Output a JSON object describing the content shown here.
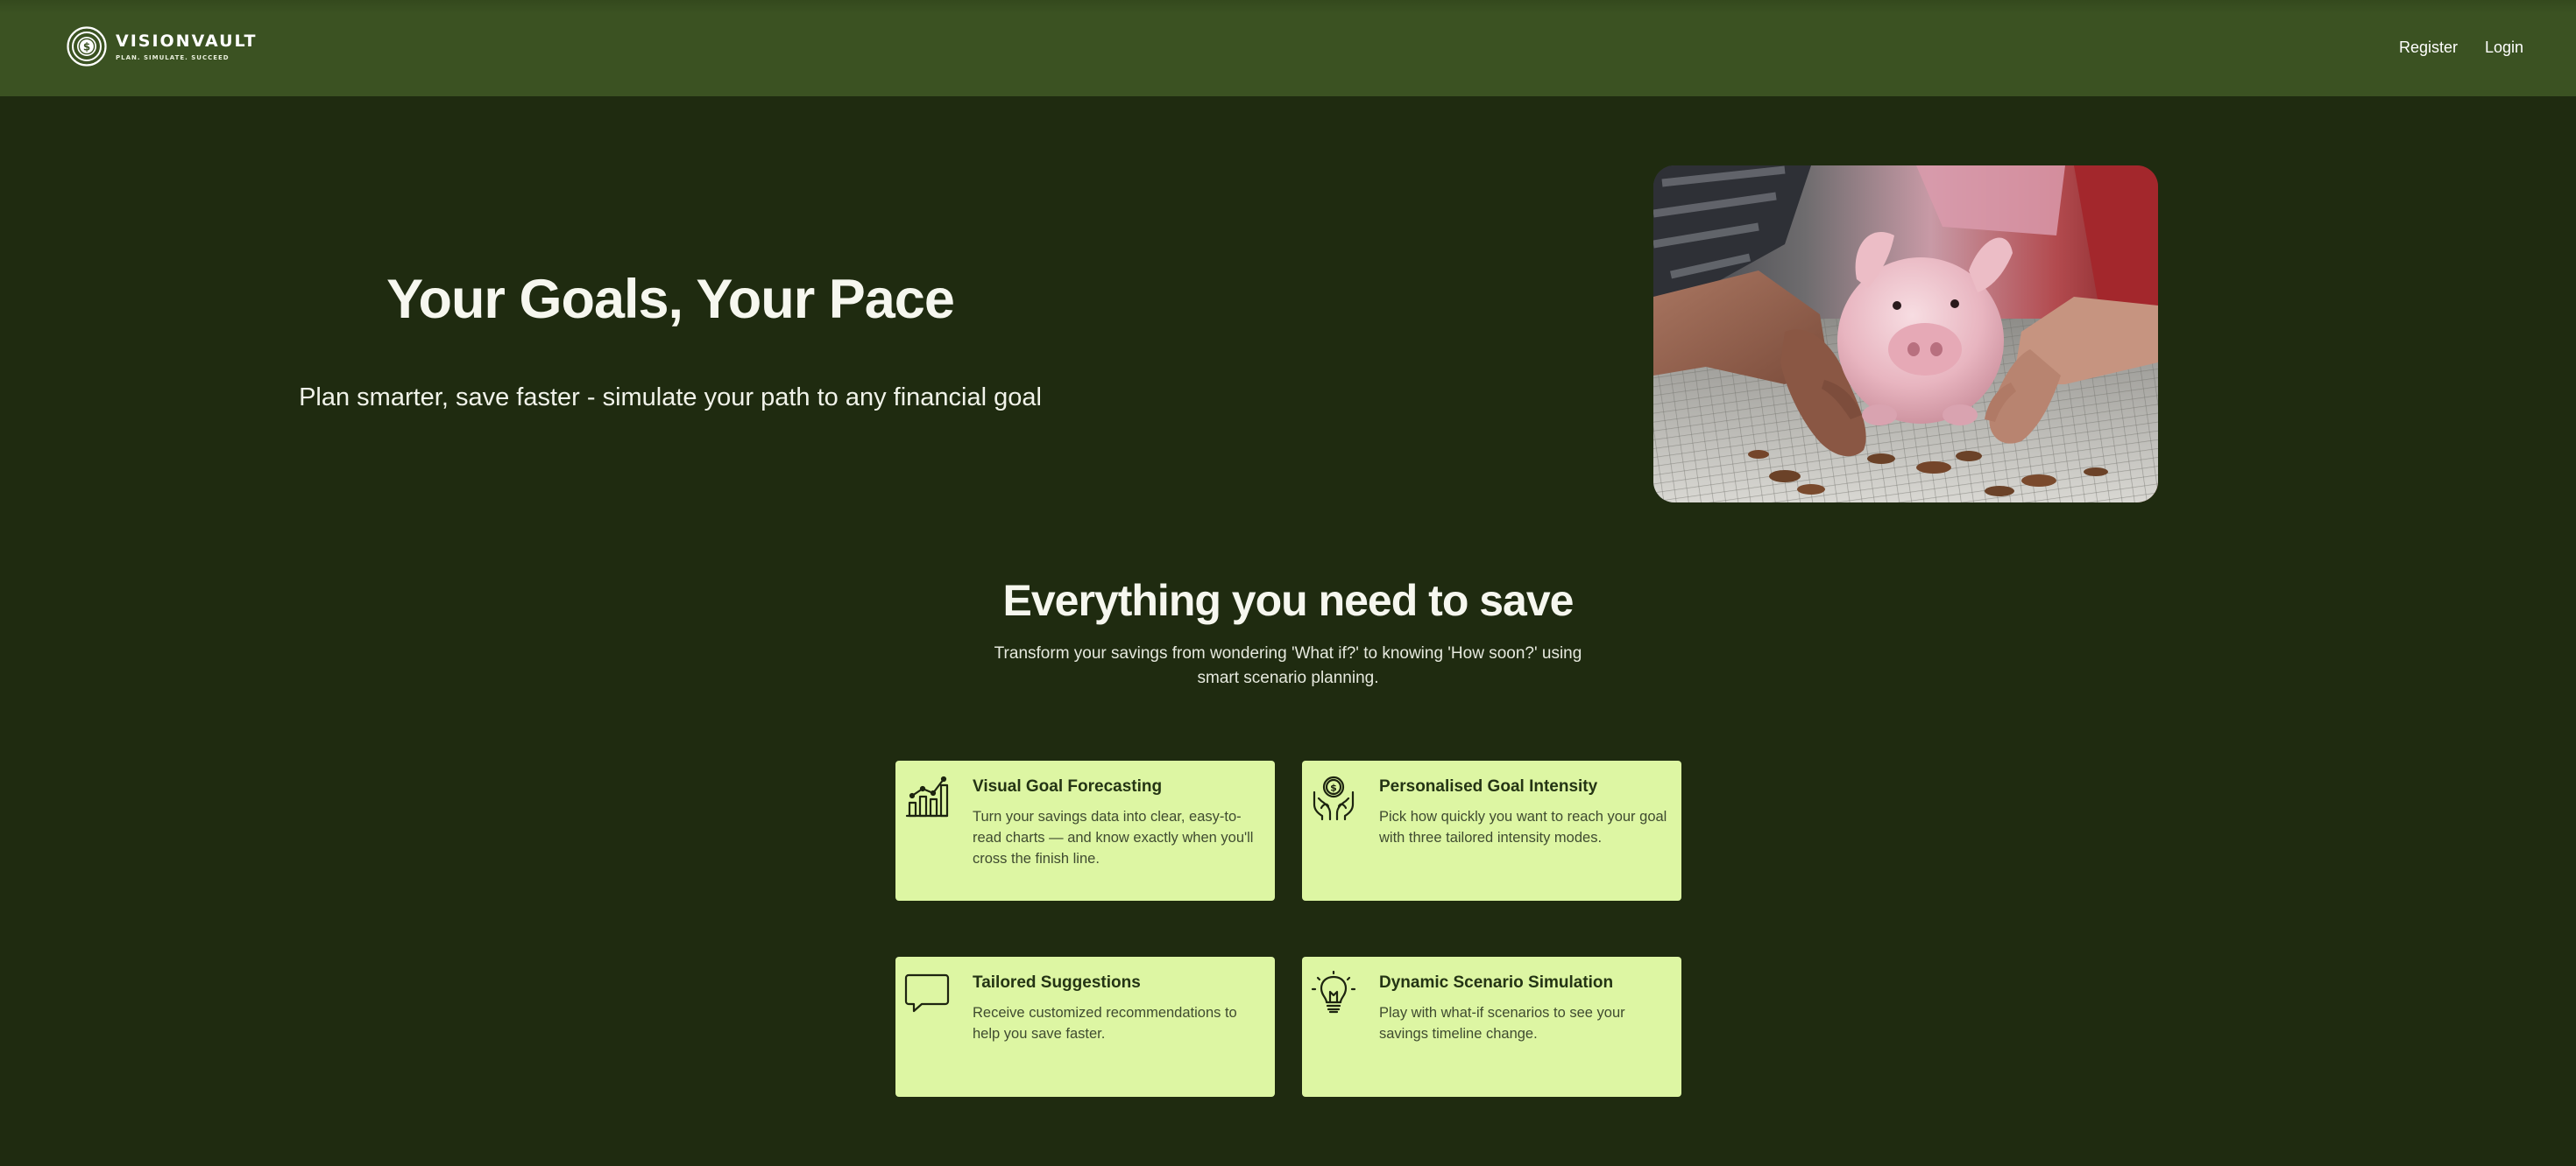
{
  "brand": {
    "name": "VISIONVAULT",
    "tagline": "PLAN. SIMULATE. SUCCEED",
    "logo_icon": "dollar-coin-icon"
  },
  "nav": {
    "register_label": "Register",
    "login_label": "Login"
  },
  "hero": {
    "title": "Your Goals, Your Pace",
    "subtitle": "Plan smarter, save faster - simulate your path to any financial goal",
    "image_icon": "piggy-bank-photo"
  },
  "features": {
    "title": "Everything you need to save",
    "description": "Transform your savings from wondering 'What if?' to knowing 'How soon?' using smart scenario planning.",
    "cards": [
      {
        "icon": "growth-chart-icon",
        "title": "Visual Goal Forecasting",
        "text": "Turn your savings data into clear, easy-to-read charts — and know exactly when you'll cross the finish line."
      },
      {
        "icon": "hands-coin-icon",
        "title": "Personalised Goal Intensity",
        "text": "Pick how quickly you want to reach your goal with three tailored intensity modes."
      },
      {
        "icon": "speech-bubble-icon",
        "title": "Tailored Suggestions",
        "text": "Receive customized recommendations to help you save faster."
      },
      {
        "icon": "lightbulb-icon",
        "title": "Dynamic Scenario Simulation",
        "text": "Play with what-if scenarios to see your savings timeline change."
      }
    ]
  },
  "colors": {
    "page_background": "#1f2b10",
    "header_background": "#3b5222",
    "card_background": "#ddf6a3",
    "card_title": "#243414",
    "text_light": "#f6f7ef"
  }
}
